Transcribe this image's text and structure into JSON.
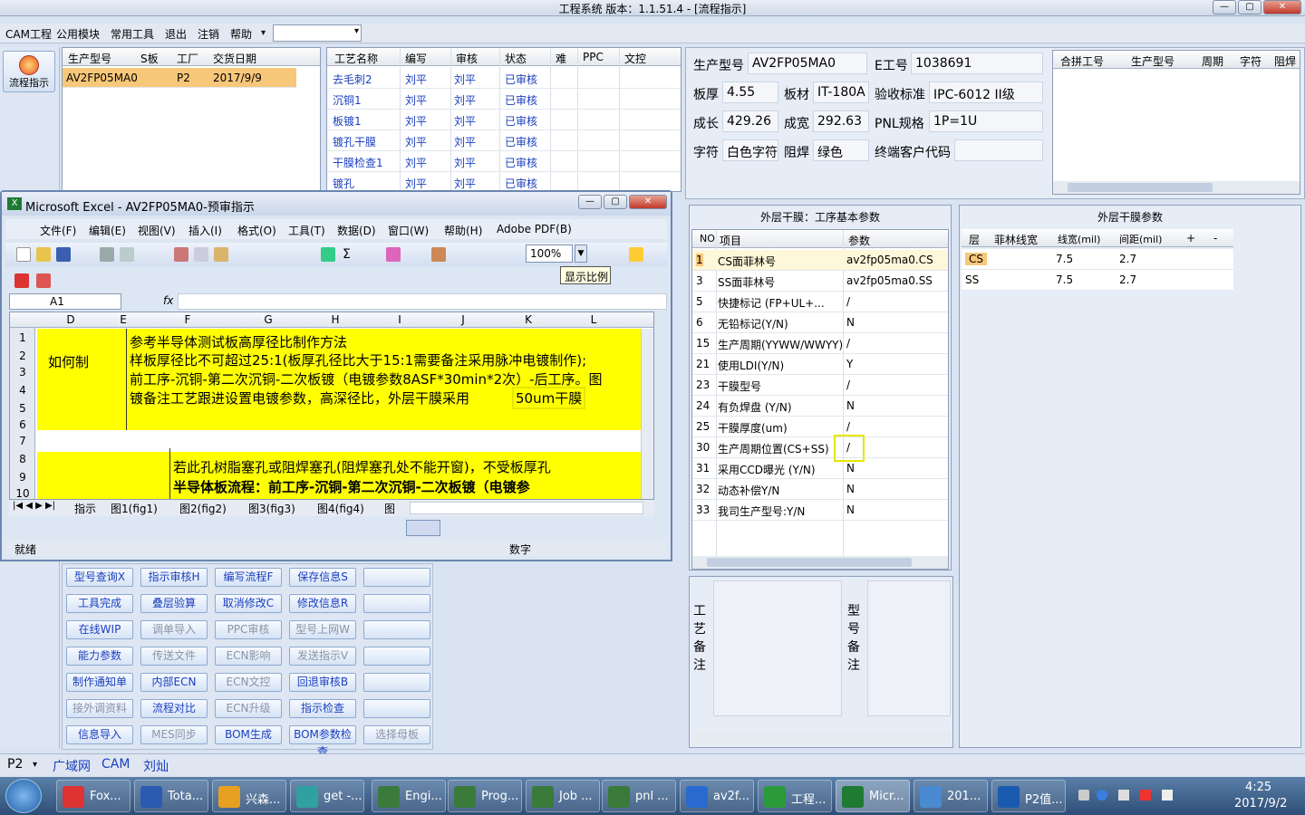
{
  "app": {
    "title": "工程系统   版本：1.1.51.4 - [流程指示]",
    "win_min": "—",
    "win_max": "▢",
    "win_close": "✕"
  },
  "menu": [
    "CAM工程",
    "公用模块",
    "常用工具",
    "退出",
    "注销",
    "帮助"
  ],
  "menu_help_arrow": "▾",
  "left_button": "流程指示",
  "order_grid": {
    "headers": [
      "生产型号",
      "S板",
      "工厂",
      "交货日期"
    ],
    "row": [
      "AV2FP05MA0",
      "",
      "P2",
      "2017/9/9"
    ]
  },
  "process_grid": {
    "headers": [
      "工艺名称",
      "编写",
      "审核",
      "状态",
      "难",
      "PPC",
      "文控"
    ],
    "rows": [
      [
        "去毛刺2",
        "刘平",
        "刘平",
        "已审核"
      ],
      [
        "沉铜1",
        "刘平",
        "刘平",
        "已审核"
      ],
      [
        "板镀1",
        "刘平",
        "刘平",
        "已审核"
      ],
      [
        "镀孔干膜",
        "刘平",
        "刘平",
        "已审核"
      ],
      [
        "干膜检查1",
        "刘平",
        "刘平",
        "已审核"
      ],
      [
        "镀孔",
        "刘平",
        "刘平",
        "已审核"
      ]
    ]
  },
  "info": {
    "model_label": "生产型号",
    "model": "AV2FP05MA0",
    "eno_label": "E工号",
    "eno": "1038691",
    "thick_label": "板厚",
    "thick": "4.55",
    "mat_label": "板材",
    "mat": "IT-180A",
    "std_label": "验收标准",
    "std": "IPC-6012 II级",
    "len_label": "成长",
    "len": "429.26",
    "wid_label": "成宽",
    "wid": "292.63",
    "pnl_label": "PNL规格",
    "pnl": "1P=1U",
    "char_label": "字符",
    "char": "白色字符",
    "mask_label": "阻焊",
    "mask": "绿色",
    "cust_label": "终端客户代码",
    "cust": ""
  },
  "merge_grid": {
    "headers": [
      "合拼工号",
      "生产型号",
      "周期",
      "字符",
      "阻焊"
    ]
  },
  "params": {
    "title": "外层干膜：工序基本参数",
    "headers": [
      "NO",
      "项目",
      "参数"
    ],
    "rows": [
      [
        "1",
        "CS面菲林号",
        "av2fp05ma0.CS"
      ],
      [
        "3",
        "SS面菲林号",
        "av2fp05ma0.SS"
      ],
      [
        "5",
        "快捷标记 (FP+UL+...",
        "/"
      ],
      [
        "6",
        "无铅标记(Y/N)",
        "N"
      ],
      [
        "15",
        "生产周期(YYWW/WWYY)",
        "/"
      ],
      [
        "21",
        "使用LDI(Y/N)",
        "Y"
      ],
      [
        "23",
        "干膜型号",
        "/"
      ],
      [
        "24",
        "有负焊盘 (Y/N)",
        "N"
      ],
      [
        "25",
        "干膜厚度(um)",
        "/"
      ],
      [
        "30",
        "生产周期位置(CS+SS)",
        "/"
      ],
      [
        "31",
        "采用CCD曝光 (Y/N)",
        "N"
      ],
      [
        "32",
        "动态补偿Y/N",
        "N"
      ],
      [
        "33",
        "我司生产型号:Y/N",
        "N"
      ]
    ]
  },
  "outer": {
    "title": "外层干膜参数",
    "headers": [
      "层",
      "菲林线宽",
      "线宽(mil)",
      "间距(mil)",
      "+",
      "-"
    ],
    "rows": [
      [
        "CS",
        "",
        "7.5",
        "2.7"
      ],
      [
        "SS",
        "",
        "7.5",
        "2.7"
      ]
    ]
  },
  "remarks": {
    "craft": "工\n艺\n备\n注",
    "model": "型\n号\n备\n注"
  },
  "func_buttons": [
    [
      [
        "型号查询X",
        1
      ],
      [
        "指示审核H",
        1
      ],
      [
        "编写流程F",
        1
      ],
      [
        "保存信息S",
        1
      ],
      [
        "",
        1
      ]
    ],
    [
      [
        "工具完成",
        1
      ],
      [
        "叠层验算",
        1
      ],
      [
        "取消修改C",
        1
      ],
      [
        "修改信息R",
        1
      ],
      [
        "",
        1
      ]
    ],
    [
      [
        "在线WIP",
        1
      ],
      [
        "调单导入",
        0
      ],
      [
        "PPC审核",
        0
      ],
      [
        "型号上网W",
        0
      ],
      [
        "",
        1
      ]
    ],
    [
      [
        "能力参数",
        1
      ],
      [
        "传送文件",
        0
      ],
      [
        "ECN影响",
        0
      ],
      [
        "发送指示V",
        0
      ],
      [
        "",
        1
      ]
    ],
    [
      [
        "制作通知单",
        1
      ],
      [
        "内部ECN",
        1
      ],
      [
        "ECN文控",
        0
      ],
      [
        "回退审核B",
        1
      ],
      [
        "",
        1
      ]
    ],
    [
      [
        "接外调资料",
        0
      ],
      [
        "流程对比",
        1
      ],
      [
        "ECN升级",
        0
      ],
      [
        "指示检查",
        1
      ],
      [
        "",
        1
      ]
    ],
    [
      [
        "信息导入",
        1
      ],
      [
        "MES同步",
        0
      ],
      [
        "BOM生成",
        1
      ],
      [
        "BOM参数检查",
        1
      ],
      [
        "选择母板",
        0
      ]
    ]
  ],
  "excel": {
    "title": "Microsoft Excel - AV2FP05MA0-预审指示",
    "menu": [
      "文件(F)",
      "编辑(E)",
      "视图(V)",
      "插入(I)",
      "格式(O)",
      "工具(T)",
      "数据(D)",
      "窗口(W)",
      "帮助(H)",
      "Adobe PDF(B)"
    ],
    "zoom": "100%",
    "tooltip": "显示比例",
    "namebox": "A1",
    "fx": "fx",
    "cols": [
      "D",
      "E",
      "F",
      "G",
      "H",
      "I",
      "J",
      "K",
      "L"
    ],
    "rows": [
      "1",
      "2",
      "3",
      "4",
      "5",
      "6",
      "7",
      "8",
      "9",
      "10"
    ],
    "label": "如何制",
    "lines": [
      "参考半导体测试板高厚径比制作方法",
      "样板厚径比不可超过25:1(板厚孔径比大于15:1需要备注采用脉冲电镀制作);",
      "前工序-沉铜-第二次沉铜-二次板镀（电镀参数8ASF*30min*2次）-后工序。图",
      "镀备注工艺跟进设置电镀参数，高深径比，外层干膜采用",
      "50um干膜",
      "若此孔树脂塞孔或阻焊塞孔(阻焊塞孔处不能开窗)，不受板厚孔",
      "半导体板流程：前工序-沉铜-第二次沉铜-二次板镀（电镀参"
    ],
    "tabs": [
      "指示",
      "图1(fig1)",
      "图2(fig2)",
      "图3(fig3)",
      "图4(fig4)",
      "图"
    ],
    "status_left": "就绪",
    "status_right": "数字"
  },
  "bottom": {
    "site": "P2",
    "items": [
      "广域网",
      "CAM",
      "刘灿"
    ]
  },
  "taskbar": {
    "tasks": [
      "Fox...",
      "Tota...",
      "兴森...",
      "get -...",
      "Engi...",
      "Prog...",
      "Job ...",
      "pnl ...",
      "av2f...",
      "工程...",
      "Micr...",
      "201...",
      "P2值..."
    ],
    "time": "4:25",
    "date": "2017/9/2"
  },
  "colors": {
    "accent": "#1a3fbf",
    "highlight": "#ffff00",
    "selection": "#f7c87a"
  }
}
